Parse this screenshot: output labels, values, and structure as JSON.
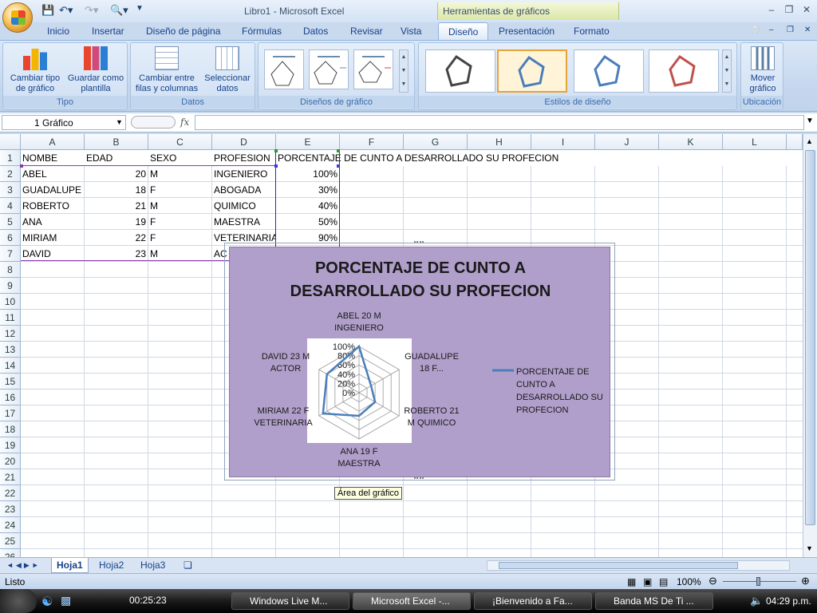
{
  "window": {
    "title": "Libro1 - Microsoft Excel",
    "contextual_group": "Herramientas de gráficos"
  },
  "tabs": [
    "Inicio",
    "Insertar",
    "Diseño de página",
    "Fórmulas",
    "Datos",
    "Revisar",
    "Vista",
    "Diseño",
    "Presentación",
    "Formato"
  ],
  "active_tab": "Diseño",
  "ribbon": {
    "tipo": {
      "label": "Tipo",
      "cambiar": "Cambiar tipo",
      "cambiar2": "de gráfico",
      "guardar": "Guardar como",
      "guardar2": "plantilla"
    },
    "datos": {
      "label": "Datos",
      "cambiar": "Cambiar entre",
      "cambiar2": "filas y columnas",
      "seleccionar": "Seleccionar",
      "seleccionar2": "datos"
    },
    "disenos": {
      "label": "Diseños de gráfico"
    },
    "estilos": {
      "label": "Estilos de diseño"
    },
    "ubicacion": {
      "label": "Ubicación",
      "mover": "Mover",
      "mover2": "gráfico"
    }
  },
  "formula_bar": {
    "name_box": "1 Gráfico",
    "fx": "fx",
    "value": ""
  },
  "columns": [
    "A",
    "B",
    "C",
    "D",
    "E",
    "F",
    "G",
    "H",
    "I",
    "J",
    "K",
    "L"
  ],
  "rows": [
    "1",
    "2",
    "3",
    "4",
    "5",
    "6",
    "7",
    "8",
    "9",
    "10",
    "11",
    "12",
    "13",
    "14",
    "15",
    "16",
    "17",
    "18",
    "19",
    "20",
    "21",
    "22",
    "23",
    "24",
    "25",
    "26"
  ],
  "cells": {
    "header": [
      "NOMBE",
      "EDAD",
      "SEXO",
      "PROFESION",
      "PORCENTAJE DE CUNTO A DESARROLLADO SU  PROFECION"
    ],
    "data": [
      [
        "ABEL",
        "20",
        "M",
        "INGENIERO",
        "100%"
      ],
      [
        "GUADALUPE",
        "18",
        "F",
        "ABOGADA",
        "30%"
      ],
      [
        "ROBERTO",
        "21",
        "M",
        "QUIMICO",
        "40%"
      ],
      [
        "ANA",
        "19",
        "F",
        "MAESTRA",
        "50%"
      ],
      [
        "MIRIAM",
        "22",
        "F",
        "VETERINARIA",
        "90%"
      ],
      [
        "DAVID",
        "23",
        "M",
        "AC",
        ""
      ]
    ]
  },
  "chart_data": {
    "type": "radar",
    "title_line1": "PORCENTAJE DE CUNTO A",
    "title_line2": "DESARROLLADO SU  PROFECION",
    "categories": [
      {
        "line1": "ABEL 20 M",
        "line2": "INGENIERO"
      },
      {
        "line1": "GUADALUPE",
        "line2": "18 F..."
      },
      {
        "line1": "ROBERTO 21",
        "line2": "M QUIMICO"
      },
      {
        "line1": "ANA 19 F",
        "line2": "MAESTRA"
      },
      {
        "line1": "MIRIAM 22 F",
        "line2": "VETERINARIA"
      },
      {
        "line1": "DAVID 23 M",
        "line2": "ACTOR"
      }
    ],
    "ticks": [
      "100%",
      "80%",
      "60%",
      "40%",
      "20%",
      "0%"
    ],
    "series": [
      {
        "name": "PORCENTAJE DE CUNTO A DESARROLLADO SU PROFECION",
        "values": [
          1.0,
          0.3,
          0.4,
          0.5,
          0.9,
          0.8
        ],
        "color": "#4a7ebb"
      }
    ],
    "ylim": [
      0,
      1
    ],
    "legend_lines": [
      "PORCENTAJE DE",
      "CUNTO A",
      "DESARROLLADO SU",
      "PROFECION"
    ],
    "legend_position": "right"
  },
  "tooltip": "Área del gráfico",
  "sheets": [
    "Hoja1",
    "Hoja2",
    "Hoja3"
  ],
  "status": {
    "mode": "Listo",
    "zoom": "100%"
  },
  "taskbar": {
    "timer": "00:25:23",
    "items": [
      "Windows Live M...",
      "Microsoft Excel -...",
      "¡Bienvenido a Fa...",
      "Banda MS De Ti ..."
    ],
    "clock": "04:29 p.m."
  }
}
